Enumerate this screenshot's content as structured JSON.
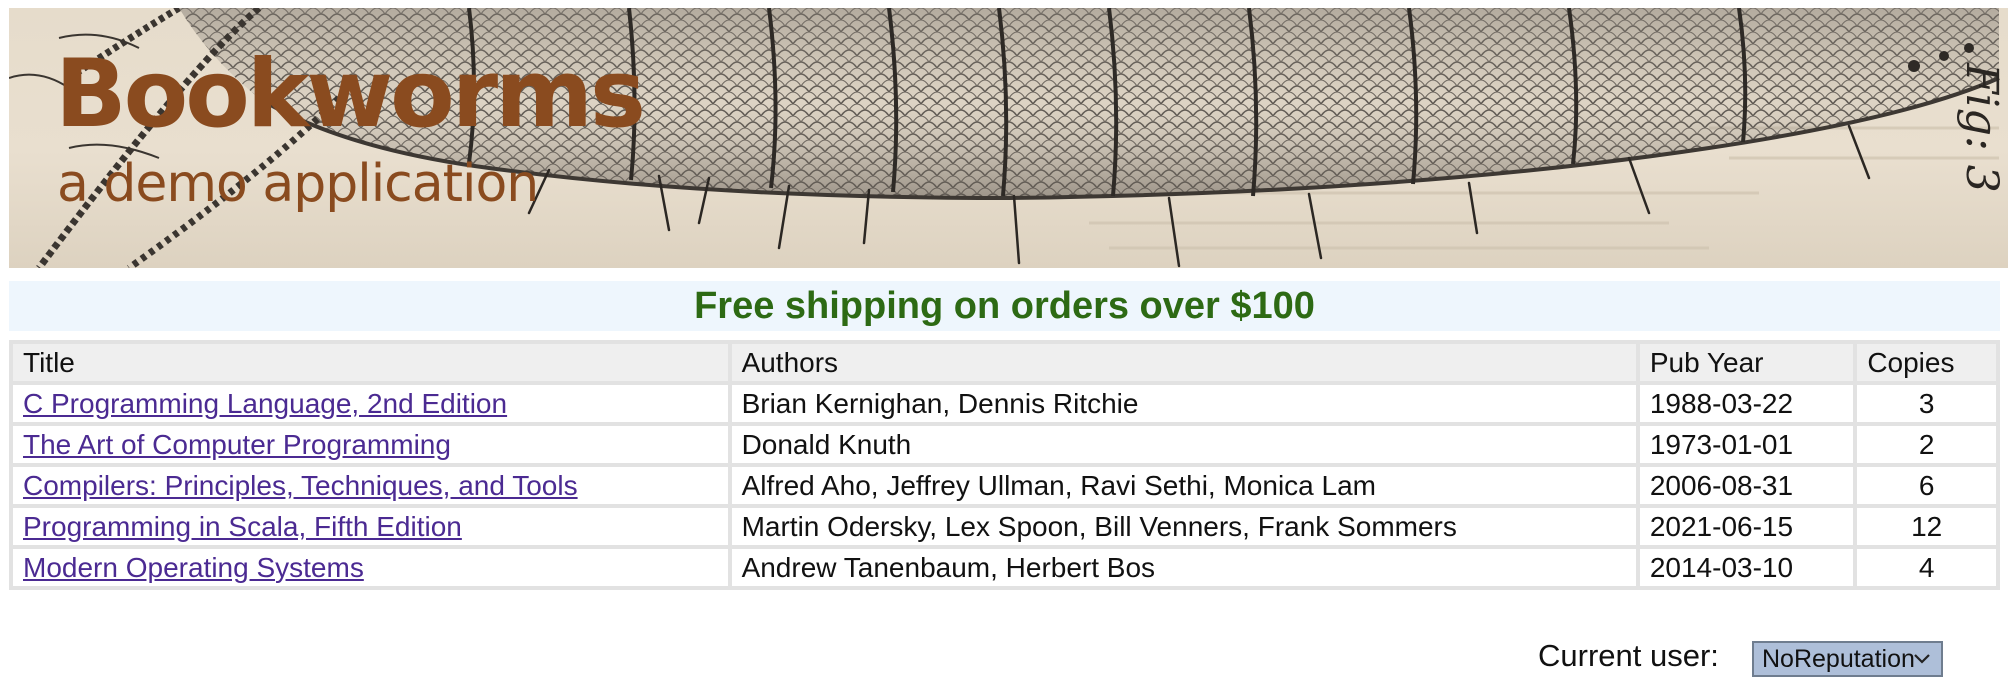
{
  "header": {
    "title": "Bookworms",
    "subtitle": "a demo application",
    "banner_caption": "Fig: 3"
  },
  "promo": {
    "text": "Free shipping on orders over $100"
  },
  "table": {
    "headers": {
      "title": "Title",
      "authors": "Authors",
      "pub_year": "Pub Year",
      "copies": "Copies"
    },
    "rows": [
      {
        "title": "C Programming Language, 2nd Edition",
        "authors": "Brian Kernighan, Dennis Ritchie",
        "pub_year": "1988-03-22",
        "copies": "3"
      },
      {
        "title": "The Art of Computer Programming",
        "authors": "Donald Knuth",
        "pub_year": "1973-01-01",
        "copies": "2"
      },
      {
        "title": "Compilers: Principles, Techniques, and Tools",
        "authors": "Alfred Aho, Jeffrey Ullman, Ravi Sethi, Monica Lam",
        "pub_year": "2006-08-31",
        "copies": "6"
      },
      {
        "title": "Programming in Scala, Fifth Edition",
        "authors": "Martin Odersky, Lex Spoon, Bill Venners, Frank Sommers",
        "pub_year": "2021-06-15",
        "copies": "12"
      },
      {
        "title": "Modern Operating Systems",
        "authors": "Andrew Tanenbaum, Herbert Bos",
        "pub_year": "2014-03-10",
        "copies": "4"
      }
    ]
  },
  "user": {
    "label": "Current user:",
    "selected": "NoReputation"
  },
  "colors": {
    "brand": "#8a4b1f",
    "promo_text": "#2d6a14",
    "promo_bg": "#eef6fd",
    "link": "#4b2a92",
    "select_bg": "#aebfd9"
  },
  "icons": {
    "select_chevron": "chevron-down-icon",
    "banner_art": "engraved-worm-illustration"
  }
}
